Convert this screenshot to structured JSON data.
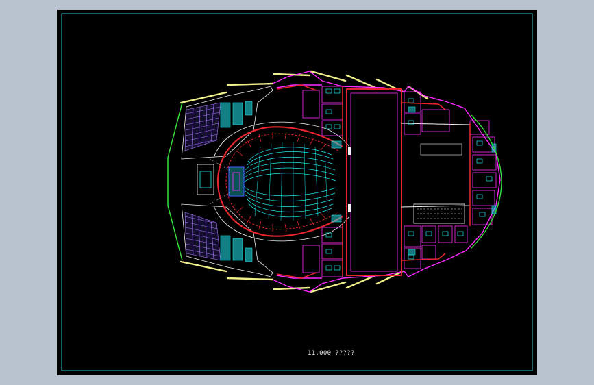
{
  "drawing": {
    "caption": "11.000 ?????",
    "colors": {
      "frame": "#28c8c8",
      "magenta": "#ff2bff",
      "red": "#e8242e",
      "cyan": "#20e8f0",
      "white": "#f2f2f2",
      "yellow": "#f0f08a",
      "green": "#36e03a",
      "blue": "#3c64ff",
      "violet": "#a878ff"
    }
  }
}
